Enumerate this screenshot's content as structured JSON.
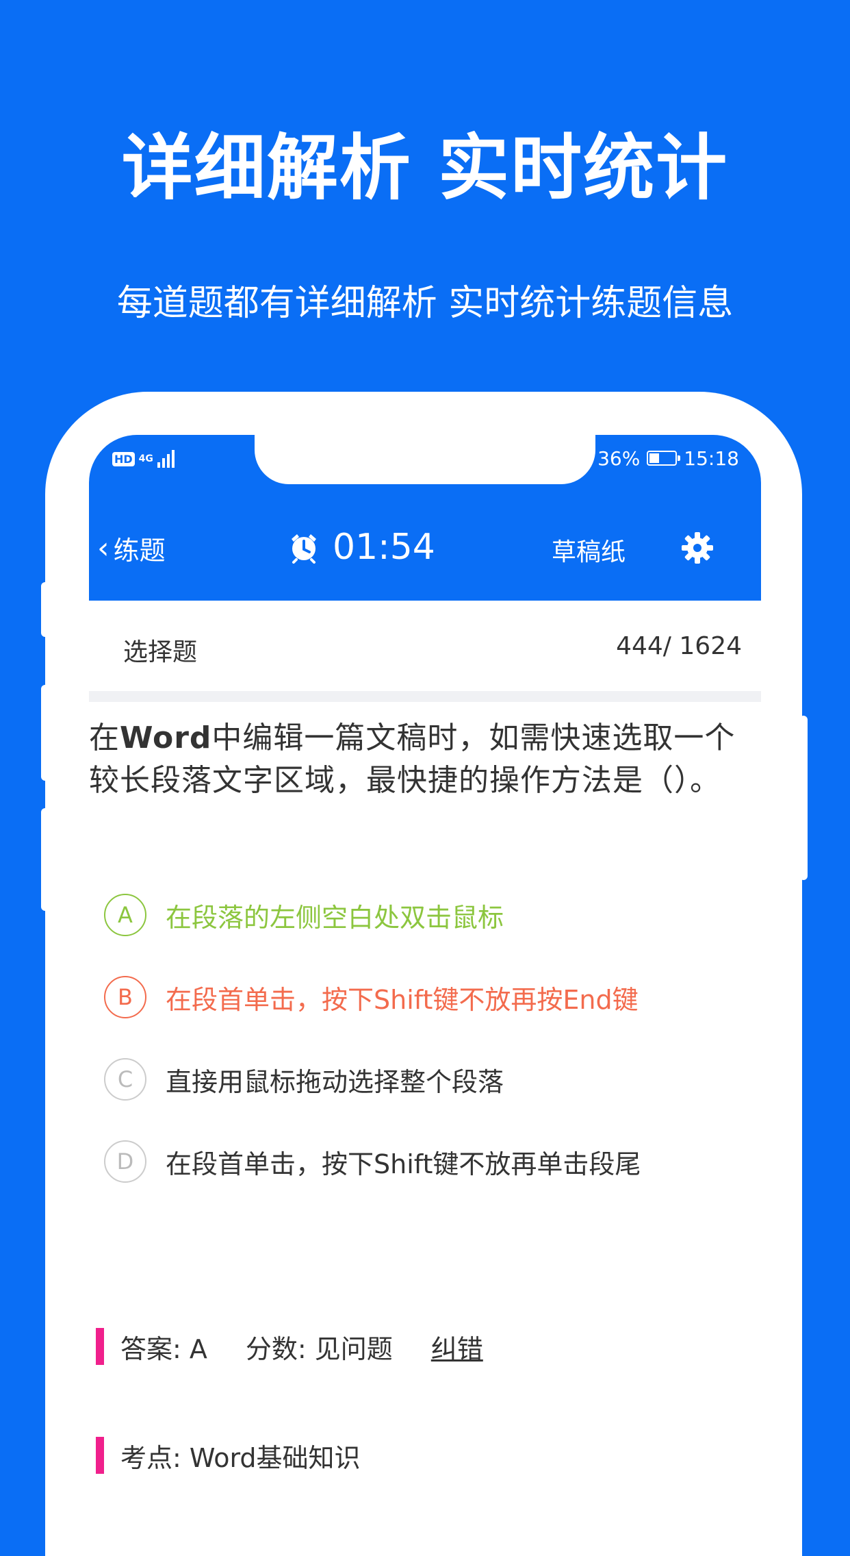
{
  "hero": {
    "title": "详细解析 实时统计",
    "subtitle": "每道题都有详细解析 实时统计练题信息"
  },
  "status_bar": {
    "hd": "HD",
    "network": "4G",
    "battery": "36%",
    "time": "15:18"
  },
  "toolbar": {
    "back_label": "练题",
    "timer": "01:54",
    "draft_label": "草稿纸"
  },
  "question_header": {
    "type": "选择题",
    "progress": "444/ 1624"
  },
  "question": {
    "prefix": "在",
    "bold": "Word",
    "suffix": "中编辑一篇文稿时，如需快速选取一个较长段落文字区域，最快捷的操作方法是（）。"
  },
  "options": [
    {
      "letter": "A",
      "text": "在段落的左侧空白处双击鼠标",
      "state": "correct"
    },
    {
      "letter": "B",
      "text": "在段首单击，按下Shift键不放再按End键",
      "state": "wrong"
    },
    {
      "letter": "C",
      "text": "直接用鼠标拖动选择整个段落",
      "state": "normal"
    },
    {
      "letter": "D",
      "text": "在段首单击，按下Shift键不放再单击段尾",
      "state": "normal"
    }
  ],
  "answer": {
    "answer_text": "答案: A",
    "score_text": "分数: 见问题",
    "report_label": "纠错"
  },
  "knowledge": {
    "text": "考点: Word基础知识"
  },
  "colors": {
    "primary": "#0a6ef5",
    "correct": "#8cc63f",
    "wrong": "#f36b4d",
    "accent_bar": "#f0208c"
  }
}
